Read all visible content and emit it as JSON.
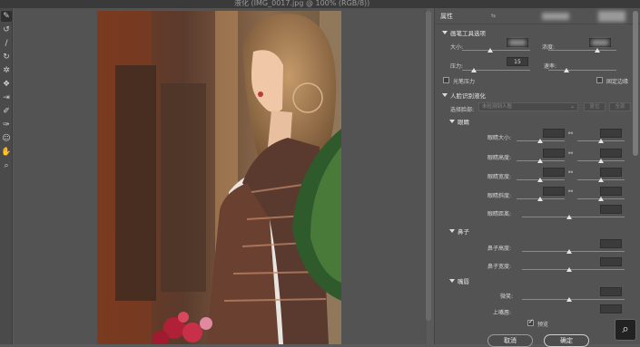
{
  "window": {
    "title": "液化 (IMG_0017.jpg @ 100% (RGB/8))"
  },
  "toolbar": {
    "tools": [
      {
        "name": "forward-warp-tool-icon",
        "glyph": "✎"
      },
      {
        "name": "reconstruct-tool-icon",
        "glyph": "↺"
      },
      {
        "name": "smooth-tool-icon",
        "glyph": "∕"
      },
      {
        "name": "twirl-tool-icon",
        "glyph": "↻"
      },
      {
        "name": "pucker-tool-icon",
        "glyph": "✲"
      },
      {
        "name": "bloat-tool-icon",
        "glyph": "❖"
      },
      {
        "name": "push-left-tool-icon",
        "glyph": "⇥"
      },
      {
        "name": "freeze-mask-tool-icon",
        "glyph": "✐"
      },
      {
        "name": "thaw-mask-tool-icon",
        "glyph": "✑"
      },
      {
        "name": "face-tool-icon",
        "glyph": "☺"
      },
      {
        "name": "hand-tool-icon",
        "glyph": "✋"
      },
      {
        "name": "zoom-tool-icon",
        "glyph": "⌕"
      }
    ]
  },
  "panel": {
    "title": "属性",
    "brush_section": "画笔工具选项",
    "size_label": "大小:",
    "density_label": "浓度:",
    "pressure_label": "压力:",
    "pressure_value": "15",
    "rate_label": "速率:",
    "stylus_label": "光笔压力",
    "pin_edges_label": "固定边缘",
    "face_section": "人脸识别液化",
    "select_face_label": "选择脸部:",
    "select_face_value": "未检测到人脸",
    "reset_label": "复位",
    "all_label": "全部",
    "eyes_section": "眼睛",
    "eye_size_label": "眼睛大小:",
    "eye_height_label": "眼睛高度:",
    "eye_width_label": "眼睛宽度:",
    "eye_tilt_label": "眼睛斜度:",
    "eye_distance_label": "眼睛距离:",
    "nose_section": "鼻子",
    "nose_height_label": "鼻子高度:",
    "nose_width_label": "鼻子宽度:",
    "mouth_section": "嘴唇",
    "smile_label": "微笑:",
    "upper_lip_label": "上嘴唇:",
    "preview_label": "预览",
    "cancel_label": "取消",
    "ok_label": "确定"
  },
  "colors": {
    "panel_bg": "#535353",
    "canvas_bg": "#535353",
    "accent": "#e4e4e4"
  }
}
